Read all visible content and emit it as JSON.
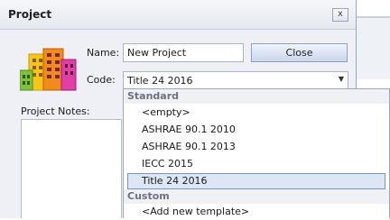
{
  "window": {
    "title": "Project",
    "close_glyph": "x"
  },
  "form": {
    "name_label": "Name:",
    "name_value": "New Project",
    "close_button": "Close",
    "code_label": "Code:",
    "code_value": "Title 24 2016",
    "notes_label": "Project Notes:"
  },
  "dropdown": {
    "groups": [
      {
        "header": "Standard",
        "items": [
          "<empty>",
          "ASHRAE 90.1 2010",
          "ASHRAE 90.1 2013",
          "IECC 2015",
          "Title 24 2016"
        ]
      },
      {
        "header": "Custom",
        "items": [
          "<Add new template>"
        ]
      }
    ],
    "selected": "Title 24 2016"
  },
  "colors": {
    "accent": "#7d93bd",
    "selection": "#dde6f5"
  }
}
